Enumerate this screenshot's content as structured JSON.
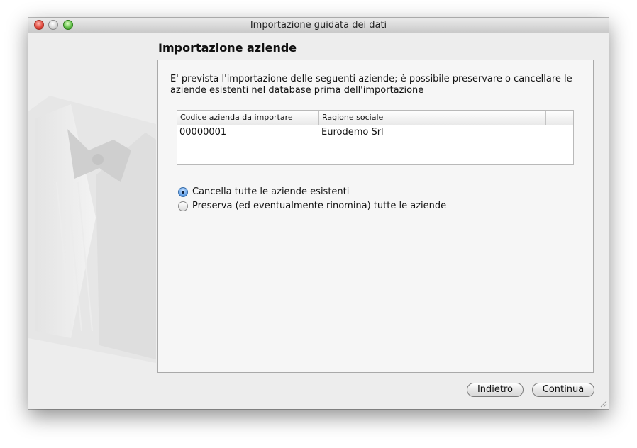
{
  "window": {
    "title": "Importazione guidata dei dati",
    "traffic_lights": [
      "close-icon",
      "minimize-icon",
      "zoom-icon"
    ]
  },
  "page": {
    "title": "Importazione aziende",
    "description": "E' prevista l'importazione delle seguenti aziende; è possibile preservare o cancellare le aziende esistenti nel database prima dell'importazione"
  },
  "table": {
    "columns": [
      "Codice azienda da importare",
      "Ragione sociale",
      ""
    ],
    "rows": [
      [
        "00000001",
        "Eurodemo Srl"
      ]
    ]
  },
  "options": [
    {
      "label": "Cancella tutte le aziende esistenti",
      "selected": true
    },
    {
      "label": "Preserva (ed eventualmente rinomina) tutte le aziende",
      "selected": false
    }
  ],
  "buttons": {
    "back": "Indietro",
    "next": "Continua"
  },
  "colors": {
    "window_bg": "#ededed",
    "panel_bg": "#f6f6f6",
    "radio_selected": "#6aa6ea"
  }
}
